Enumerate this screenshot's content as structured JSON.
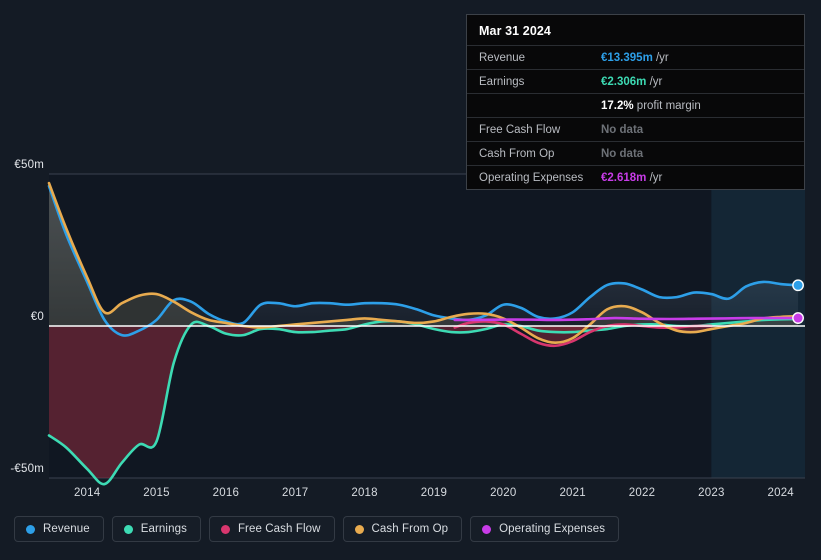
{
  "chart_data": {
    "type": "line",
    "title": "",
    "xlabel": "",
    "ylabel": "",
    "currency": "EUR",
    "units": "millions",
    "grid": true,
    "legend_position": "bottom",
    "xlim": [
      2013.45,
      2024.35
    ],
    "ylim": [
      -55,
      52
    ],
    "y_ticks": [
      {
        "value": 50,
        "label": "€50m"
      },
      {
        "value": 0,
        "label": "€0"
      },
      {
        "value": -50,
        "label": "-€50m"
      }
    ],
    "x_ticks": [
      "2014",
      "2015",
      "2016",
      "2017",
      "2018",
      "2019",
      "2020",
      "2021",
      "2022",
      "2023",
      "2024"
    ],
    "highlight_band": {
      "from": 2023.0,
      "to": 2024.35,
      "note": "shaded forecast/recent period"
    },
    "series": [
      {
        "name": "Revenue",
        "color": "#2d9fe8",
        "endpoint_marker": true,
        "x": [
          2013.45,
          2013.7,
          2014.0,
          2014.25,
          2014.5,
          2014.75,
          2015.0,
          2015.25,
          2015.5,
          2015.75,
          2016.0,
          2016.25,
          2016.5,
          2016.75,
          2017.0,
          2017.25,
          2017.5,
          2017.75,
          2018.0,
          2018.25,
          2018.5,
          2018.75,
          2019.0,
          2019.25,
          2019.5,
          2019.75,
          2020.0,
          2020.25,
          2020.5,
          2020.75,
          2021.0,
          2021.25,
          2021.5,
          2021.75,
          2022.0,
          2022.25,
          2022.5,
          2022.75,
          2023.0,
          2023.25,
          2023.5,
          2023.75,
          2024.0,
          2024.25
        ],
        "y": [
          46.0,
          30.0,
          14.5,
          2.0,
          -3.0,
          -1.5,
          2.0,
          8.5,
          8.0,
          4.0,
          1.5,
          1.0,
          7.0,
          7.5,
          6.5,
          7.5,
          7.5,
          7.0,
          7.5,
          7.5,
          7.0,
          5.5,
          3.5,
          2.5,
          2.0,
          3.5,
          7.0,
          6.0,
          3.0,
          2.5,
          4.5,
          9.5,
          13.5,
          14.0,
          12.0,
          9.5,
          9.5,
          11.0,
          10.5,
          9.0,
          13.0,
          14.5,
          13.8,
          13.395
        ]
      },
      {
        "name": "Earnings",
        "color": "#3ddbb4",
        "endpoint_marker": false,
        "x": [
          2013.45,
          2013.7,
          2014.0,
          2014.25,
          2014.5,
          2014.75,
          2015.0,
          2015.25,
          2015.5,
          2015.75,
          2016.0,
          2016.25,
          2016.5,
          2016.75,
          2017.0,
          2017.25,
          2017.5,
          2017.75,
          2018.0,
          2018.25,
          2018.5,
          2018.75,
          2019.0,
          2019.25,
          2019.5,
          2019.75,
          2020.0,
          2020.25,
          2020.5,
          2020.75,
          2021.0,
          2021.25,
          2021.5,
          2021.75,
          2022.0,
          2022.25,
          2022.5,
          2022.75,
          2023.0,
          2023.25,
          2023.5,
          2023.75,
          2024.0,
          2024.25
        ],
        "y": [
          -36.0,
          -40.0,
          -47.0,
          -52.0,
          -45.0,
          -39.0,
          -38.0,
          -12.0,
          0.5,
          0.0,
          -2.5,
          -3.0,
          -1.0,
          -1.0,
          -2.0,
          -2.0,
          -1.5,
          -1.0,
          0.5,
          1.5,
          1.5,
          0.5,
          -1.0,
          -2.0,
          -2.0,
          -1.0,
          0.5,
          0.0,
          -1.5,
          -2.0,
          -2.0,
          -1.5,
          -1.0,
          0.0,
          0.5,
          0.5,
          0.0,
          0.0,
          0.5,
          1.0,
          1.5,
          2.0,
          2.2,
          2.306
        ]
      },
      {
        "name": "Free Cash Flow",
        "color": "#d8366e",
        "endpoint_marker": false,
        "starts_at": 2019.3,
        "x": [
          2019.3,
          2019.5,
          2019.75,
          2020.0,
          2020.25,
          2020.5,
          2020.75,
          2021.0,
          2021.25,
          2021.5,
          2021.75,
          2022.0,
          2022.25,
          2022.5,
          2022.75,
          2023.0
        ],
        "y": [
          -0.5,
          1.0,
          1.5,
          0.5,
          -2.5,
          -5.5,
          -6.5,
          -5.0,
          -2.0,
          0.0,
          0.5,
          0.0,
          -0.5,
          -0.5,
          0.0,
          0.0
        ]
      },
      {
        "name": "Cash From Op",
        "color": "#e8ab4f",
        "endpoint_marker": false,
        "x": [
          2013.45,
          2013.7,
          2014.0,
          2014.25,
          2014.5,
          2014.75,
          2015.0,
          2015.25,
          2015.5,
          2015.75,
          2016.0,
          2016.25,
          2016.5,
          2016.75,
          2017.0,
          2017.25,
          2017.5,
          2017.75,
          2018.0,
          2018.25,
          2018.5,
          2018.75,
          2019.0,
          2019.25,
          2019.5,
          2019.75,
          2020.0,
          2020.25,
          2020.5,
          2020.75,
          2021.0,
          2021.25,
          2021.5,
          2021.75,
          2022.0,
          2022.25,
          2022.5,
          2022.75,
          2023.0,
          2023.25,
          2023.5,
          2023.75,
          2024.0,
          2024.25
        ],
        "y": [
          47.0,
          32.0,
          16.0,
          4.5,
          7.5,
          10.0,
          10.5,
          8.0,
          4.5,
          2.0,
          1.0,
          0.0,
          -0.5,
          0.0,
          0.5,
          1.0,
          1.5,
          2.0,
          2.5,
          2.0,
          1.5,
          1.0,
          1.5,
          3.0,
          4.0,
          4.0,
          2.5,
          -0.5,
          -4.0,
          -5.5,
          -4.0,
          0.5,
          5.5,
          6.5,
          4.5,
          1.0,
          -1.5,
          -2.0,
          -1.0,
          0.0,
          1.0,
          2.5,
          3.0,
          3.2
        ]
      },
      {
        "name": "Operating Expenses",
        "color": "#c83ce8",
        "endpoint_marker": true,
        "starts_at": 2019.3,
        "x": [
          2019.3,
          2019.6,
          2020.0,
          2020.4,
          2020.8,
          2021.2,
          2021.6,
          2022.0,
          2022.4,
          2022.8,
          2023.2,
          2023.6,
          2024.0,
          2024.25
        ],
        "y": [
          2.0,
          2.0,
          2.1,
          2.1,
          2.0,
          2.2,
          2.6,
          2.4,
          2.3,
          2.4,
          2.5,
          2.6,
          2.6,
          2.618
        ]
      }
    ]
  },
  "tooltip": {
    "title": "Mar 31 2024",
    "rows": [
      {
        "label": "Revenue",
        "amount": "€13.395m",
        "unit": "/yr",
        "style": "revenue",
        "no_data": false
      },
      {
        "label": "Earnings",
        "amount": "€2.306m",
        "unit": "/yr",
        "style": "earnings",
        "no_data": false
      },
      {
        "label": "",
        "amount": "17.2%",
        "unit": "profit margin",
        "style": "margin",
        "no_data": false
      },
      {
        "label": "Free Cash Flow",
        "amount": "No data",
        "unit": "",
        "style": "nodata",
        "no_data": true
      },
      {
        "label": "Cash From Op",
        "amount": "No data",
        "unit": "",
        "style": "nodata",
        "no_data": true
      },
      {
        "label": "Operating Expenses",
        "amount": "€2.618m",
        "unit": "/yr",
        "style": "opex",
        "no_data": false
      }
    ]
  },
  "legend": {
    "items": [
      {
        "label": "Revenue",
        "color": "#2d9fe8"
      },
      {
        "label": "Earnings",
        "color": "#3ddbb4"
      },
      {
        "label": "Free Cash Flow",
        "color": "#d8366e"
      },
      {
        "label": "Cash From Op",
        "color": "#e8ab4f"
      },
      {
        "label": "Operating Expenses",
        "color": "#c83ce8"
      }
    ]
  },
  "colors": {
    "background": "#141b25",
    "plot_background": "#101722",
    "zero_line": "#ffffff",
    "grid": "#3a4250"
  }
}
